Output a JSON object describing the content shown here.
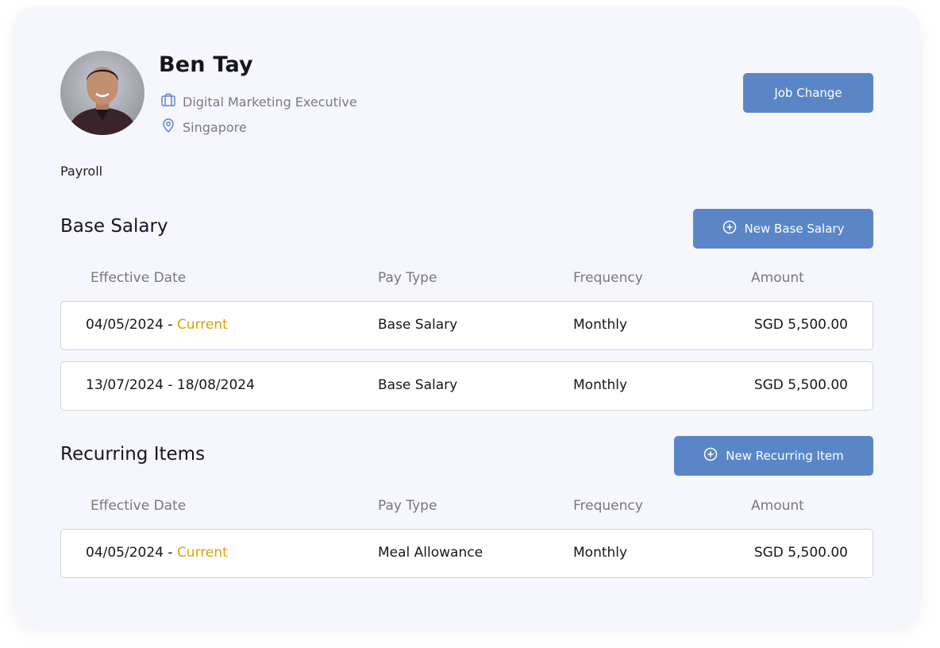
{
  "profile": {
    "name": "Ben Tay",
    "job_title": "Digital Marketing Executive",
    "location": "Singapore"
  },
  "actions": {
    "job_change": "Job Change",
    "new_base_salary": "New Base Salary",
    "new_recurring_item": "New Recurring Item"
  },
  "section_label": "Payroll",
  "base_salary": {
    "title": "Base Salary",
    "headers": [
      "Effective Date",
      "Pay Type",
      "Frequency",
      "Amount"
    ],
    "rows": [
      {
        "date": "04/05/2024 - ",
        "status": "Current",
        "pay_type": "Base Salary",
        "frequency": "Monthly",
        "amount": "SGD 5,500.00"
      },
      {
        "date": "13/07/2024 - 18/08/2024",
        "status": "",
        "pay_type": "Base Salary",
        "frequency": "Monthly",
        "amount": "SGD 5,500.00"
      }
    ]
  },
  "recurring_items": {
    "title": "Recurring Items",
    "headers": [
      "Effective Date",
      "Pay Type",
      "Frequency",
      "Amount"
    ],
    "rows": [
      {
        "date": "04/05/2024 - ",
        "status": "Current",
        "pay_type": "Meal Allowance",
        "frequency": "Monthly",
        "amount": "SGD 5,500.00"
      }
    ]
  },
  "colors": {
    "accent": "#5a86c8",
    "current": "#d9a107",
    "background": "#f6f6fd"
  },
  "icons": [
    "briefcase-icon",
    "location-pin-icon",
    "plus-circle-icon"
  ]
}
